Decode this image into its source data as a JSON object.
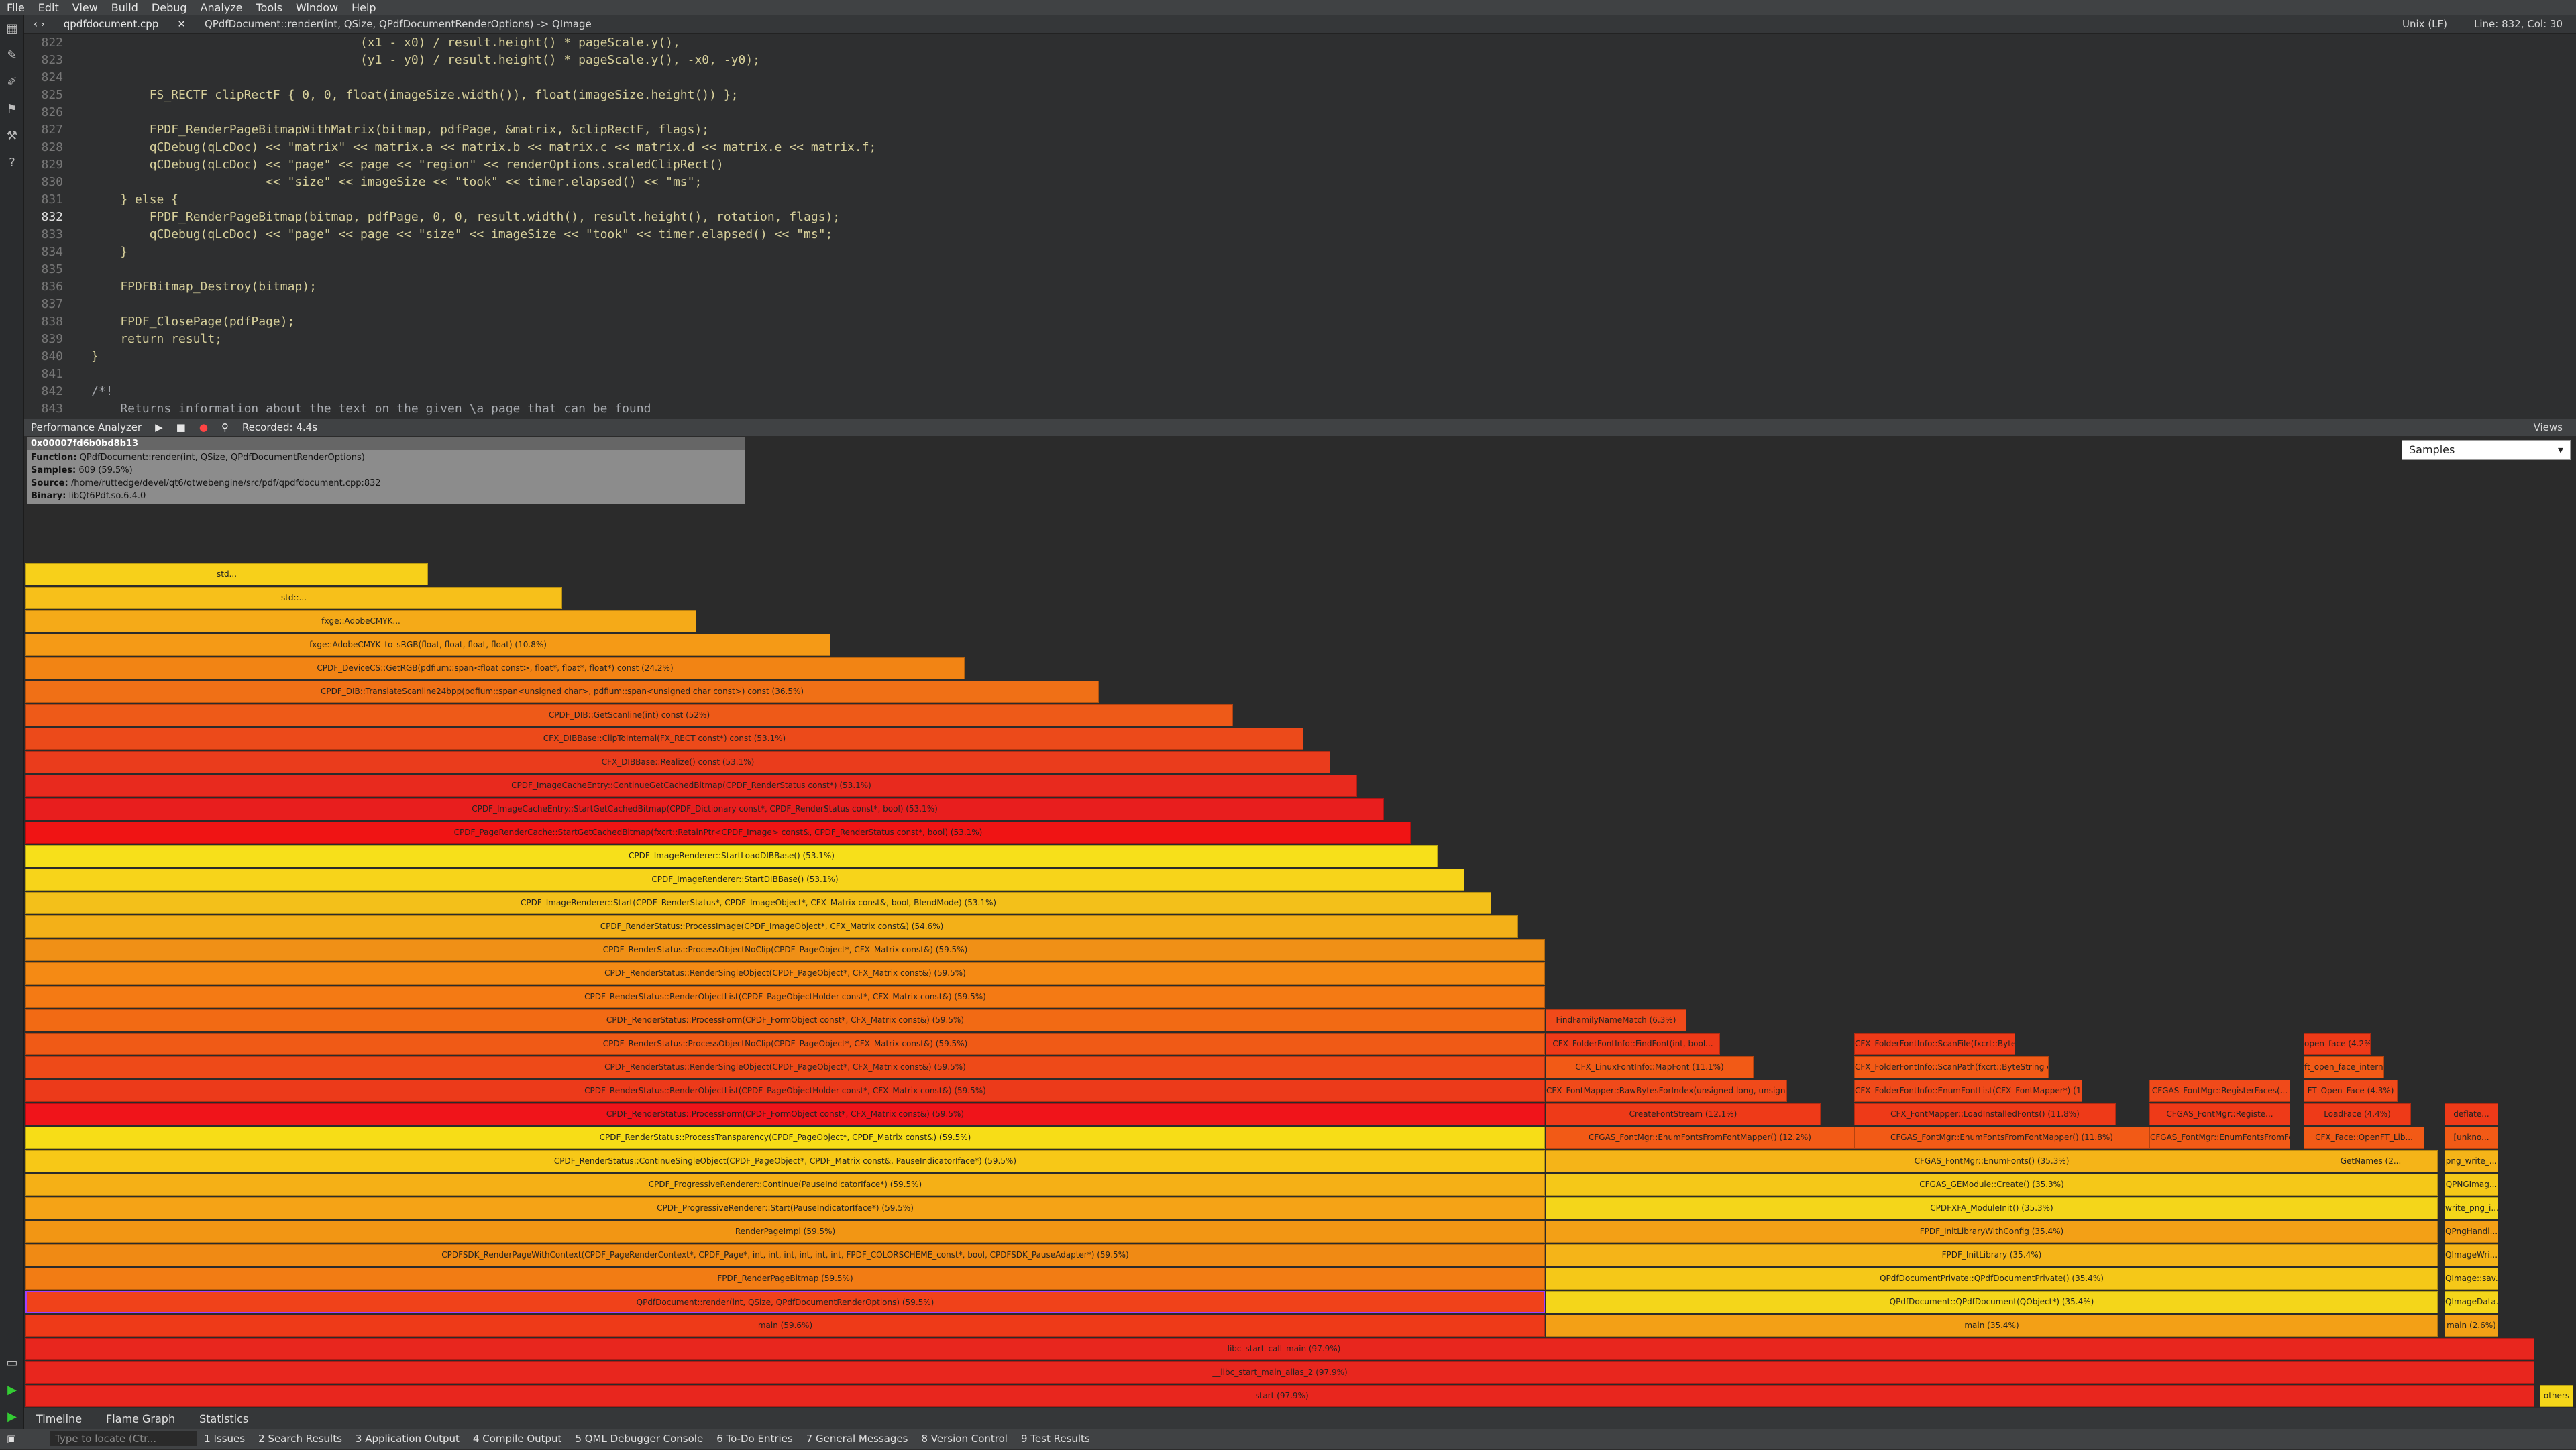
{
  "menu": [
    "File",
    "Edit",
    "View",
    "Build",
    "Debug",
    "Analyze",
    "Tools",
    "Window",
    "Help"
  ],
  "editor_toolbar": {
    "file": "qpdfdocument.cpp",
    "function": "QPdfDocument::render(int, QSize, QPdfDocumentRenderOptions) -> QImage",
    "encoding": "Unix (LF)",
    "position": "Line: 832, Col: 30"
  },
  "code_lines": [
    {
      "n": "822",
      "text": "                                     (x1 - x0) / result.height() * pageScale.y(),"
    },
    {
      "n": "823",
      "text": "                                     (y1 - y0) / result.height() * pageScale.y(), -x0, -y0);"
    },
    {
      "n": "824",
      "text": ""
    },
    {
      "n": "825",
      "text": "        FS_RECTF clipRectF { 0, 0, float(imageSize.width()), float(imageSize.height()) };"
    },
    {
      "n": "826",
      "text": ""
    },
    {
      "n": "827",
      "text": "        FPDF_RenderPageBitmapWithMatrix(bitmap, pdfPage, &matrix, &clipRectF, flags);"
    },
    {
      "n": "828",
      "text": "        qCDebug(qLcDoc) << \"matrix\" << matrix.a << matrix.b << matrix.c << matrix.d << matrix.e << matrix.f;"
    },
    {
      "n": "829",
      "text": "        qCDebug(qLcDoc) << \"page\" << page << \"region\" << renderOptions.scaledClipRect()"
    },
    {
      "n": "830",
      "text": "                        << \"size\" << imageSize << \"took\" << timer.elapsed() << \"ms\";"
    },
    {
      "n": "831",
      "text": "    } else {"
    },
    {
      "n": "832",
      "text": "        FPDF_RenderPageBitmap(bitmap, pdfPage, 0, 0, result.width(), result.height(), rotation, flags);"
    },
    {
      "n": "833",
      "text": "        qCDebug(qLcDoc) << \"page\" << page << \"size\" << imageSize << \"took\" << timer.elapsed() << \"ms\";"
    },
    {
      "n": "834",
      "text": "    }"
    },
    {
      "n": "835",
      "text": ""
    },
    {
      "n": "836",
      "text": "    FPDFBitmap_Destroy(bitmap);"
    },
    {
      "n": "837",
      "text": ""
    },
    {
      "n": "838",
      "text": "    FPDF_ClosePage(pdfPage);"
    },
    {
      "n": "839",
      "text": "    return result;"
    },
    {
      "n": "840",
      "text": "}"
    },
    {
      "n": "841",
      "text": ""
    },
    {
      "n": "842",
      "text": "/*!"
    },
    {
      "n": "843",
      "text": "    Returns information about the text on the given \\a page that can be found"
    }
  ],
  "perf_toolbar": {
    "title": "Performance Analyzer",
    "recorded": "Recorded: 4.4s",
    "views": "Views"
  },
  "tooltip": {
    "address": "0x00007fd6b0bd8b13",
    "function_label": "Function:",
    "function": "QPdfDocument::render(int, QSize, QPdfDocumentRenderOptions)",
    "samples_label": "Samples:",
    "samples": "609 (59.5%)",
    "source_label": "Source:",
    "source": "/home/ruttedge/devel/qt6/qtwebengine/src/pdf/qpdfdocument.cpp:832",
    "binary_label": "Binary:",
    "binary": "libQt6Pdf.so.6.4.0"
  },
  "samples_select": "Samples",
  "flame_rows": [
    {
      "label": "_start (97.9%)",
      "color": "#e8261e"
    },
    {
      "label": "__libc_start_main_alias_2 (97.9%)",
      "color": "#e8261e"
    },
    {
      "label": "__libc_start_call_main (97.9%)",
      "color": "#e8261e"
    },
    {
      "label": "main (59.6%)",
      "color": "#ee3a18"
    },
    {
      "label": "QPdfDocument::render(int, QSize, QPdfDocumentRenderOptions) (59.5%)",
      "color": "#f0421a"
    },
    {
      "label": "FPDF_RenderPageBitmap (59.5%)",
      "color": "#f27c14"
    },
    {
      "label": "CPDFSDK_RenderPageWithContext(CPDF_PageRenderContext*, CPDF_Page*, int, int, int, int, int, int, FPDF_COLORSCHEME_const*, bool, CPDFSDK_PauseAdapter*) (59.5%)",
      "color": "#f08a14"
    },
    {
      "label": "RenderPageImpl (59.5%)",
      "color": "#f29614"
    },
    {
      "label": "CPDF_ProgressiveRenderer::Start(PauseIndicatorIface*) (59.5%)",
      "color": "#f5a316"
    },
    {
      "label": "CPDF_ProgressiveRenderer::Continue(PauseIndicatorIface*) (59.5%)",
      "color": "#f5b016"
    },
    {
      "label": "CPDF_RenderStatus::ContinueSingleObject(CPDF_PageObject*, CPDF_Matrix const&, PauseIndicatorIface*) (59.5%)",
      "color": "#f7c817"
    },
    {
      "label": "CPDF_RenderStatus::ProcessTransparency(CPDF_PageObject*, CPDF_Matrix const&) (59.5%)",
      "color": "#f7dd17"
    },
    {
      "label": "CPDF_RenderStatus::ProcessForm(CPDF_FormObject const*, CFX_Matrix const&) (59.5%)",
      "color": "#f0141a"
    },
    {
      "label": "CPDF_RenderStatus::RenderObjectList(CPDF_PageObjectHolder const*, CFX_Matrix const&) (59.5%)",
      "color": "#ec3a1a"
    },
    {
      "label": "CPDF_RenderStatus::RenderSingleObject(CPDF_PageObject*, CFX_Matrix const&) (59.5%)",
      "color": "#ee4a18"
    },
    {
      "label": "CPDF_RenderStatus::ProcessObjectNoClip(CPDF_PageObject*, CFX_Matrix const&) (59.5%)",
      "color": "#f05a16"
    },
    {
      "label": "CPDF_RenderStatus::ProcessForm(CPDF_FormObject const*, CFX_Matrix const&) (59.5%)",
      "color": "#f26a14"
    },
    {
      "label": "CPDF_RenderStatus::RenderObjectList(CPDF_PageObjectHolder const*, CFX_Matrix const&) (59.5%)",
      "color": "#f47a14"
    },
    {
      "label": "CPDF_RenderStatus::RenderSingleObject(CPDF_PageObject*, CFX_Matrix const&) (59.5%)",
      "color": "#f58a14"
    },
    {
      "label": "CPDF_RenderStatus::ProcessObjectNoClip(CPDF_PageObject*, CFX_Matrix const&) (59.5%)",
      "color": "#f09016"
    },
    {
      "label": "CPDF_RenderStatus::ProcessImage(CPDF_ImageObject*, CFX_Matrix const&) (54.6%)",
      "color": "#f3b018"
    },
    {
      "label": "CPDF_ImageRenderer::Start(CPDF_RenderStatus*, CPDF_ImageObject*, CFX_Matrix const&, bool, BlendMode) (53.1%)",
      "color": "#f3c01a"
    },
    {
      "label": "CPDF_ImageRenderer::StartDIBBase() (53.1%)",
      "color": "#f7d41a"
    },
    {
      "label": "CPDF_ImageRenderer::StartLoadDIBBase() (53.1%)",
      "color": "#f7e01a"
    },
    {
      "label": "CPDF_PageRenderCache::StartGetCachedBitmap(fxcrt::RetainPtr<CPDF_Image> const&, CPDF_RenderStatus const*, bool) (53.1%)",
      "color": "#f01414"
    },
    {
      "label": "CPDF_ImageCacheEntry::StartGetCachedBitmap(CPDF_Dictionary const*, CPDF_RenderStatus const*, bool) (53.1%)",
      "color": "#e81e1e"
    },
    {
      "label": "CPDF_ImageCacheEntry::ContinueGetCachedBitmap(CPDF_RenderStatus const*) (53.1%)",
      "color": "#e82a1e"
    },
    {
      "label": "CFX_DIBBase::Realize() const (53.1%)",
      "color": "#ea3c1c"
    },
    {
      "label": "CFX_DIBBase::ClipToInternal(FX_RECT const*) const (53.1%)",
      "color": "#ec4a1a"
    },
    {
      "label": "CPDF_DIB::GetScanline(int) const (52%)",
      "color": "#ee5a18"
    },
    {
      "label": "CPDF_DIB::TranslateScanline24bpp(pdfium::span<unsigned char>, pdfium::span<unsigned char const>) const (36.5%)",
      "color": "#f07016"
    },
    {
      "label": "CPDF_DeviceCS::GetRGB(pdfium::span<float const>, float*, float*, float*) const (24.2%)",
      "color": "#f28414"
    },
    {
      "label": "fxge::AdobeCMYK_to_sRGB(float, float, float, float) (10.8%)",
      "color": "#f59a16"
    },
    {
      "label": "fxge::AdobeCMYK...",
      "color": "#f5aa18"
    },
    {
      "label": "std::...",
      "color": "#f7c01a"
    },
    {
      "label": "std...",
      "color": "#f7d01a"
    }
  ],
  "flame_right": [
    {
      "label": "main (35.4%)"
    },
    {
      "label": "QPdfDocument::QPdfDocument(QObject*) (35.4%)"
    },
    {
      "label": "QPdfDocumentPrivate::QPdfDocumentPrivate() (35.4%)"
    },
    {
      "label": "FPDF_InitLibrary (35.4%)"
    },
    {
      "label": "FPDF_InitLibraryWithConfig (35.4%)"
    },
    {
      "label": "CPDFXFA_ModuleInit() (35.3%)"
    },
    {
      "label": "CFGAS_GEModule::Create() (35.3%)"
    },
    {
      "label": "CFGAS_FontMgr::EnumFonts() (35.3%)"
    },
    {
      "label": "CFGAS_FontMgr::EnumFontsFromFontMapper() (12.2%)"
    },
    {
      "label": "CreateFontStream (12.1%)"
    },
    {
      "label": "CFX_FontMapper::RawBytesForIndex(unsigned long, unsigned long)"
    },
    {
      "label": "CFX_LinuxFontInfo::MapFont (11.1%)"
    },
    {
      "label": "CFX_FolderFontInfo::FindFont(int, bool..."
    },
    {
      "label": "FindFamilyNameMatch (6.3%)"
    },
    {
      "label": "CFGAS_FontMgr::EnumFontsFromFontMapper() (11.8%)"
    },
    {
      "label": "CFX_FontMapper::LoadInstalledFonts() (11.8%)"
    },
    {
      "label": "CFX_FolderFontInfo::EnumFontList(CFX_FontMapper*) (11.8%)"
    },
    {
      "label": "CFX_FolderFontInfo::ScanPath(fxcrt::ByteString const&) (11.8%)"
    },
    {
      "label": "CFX_FolderFontInfo::ScanFile(fxcrt::ByteString co..."
    },
    {
      "label": "CFGAS_FontMgr::EnumFontsFromFontMapper() (10.4%)"
    },
    {
      "label": "CFGAS_FontMgr::Registe..."
    },
    {
      "label": "CFGAS_FontMgr::RegisterFaces(..."
    },
    {
      "label": "GetNames (2..."
    },
    {
      "label": "CFX_Face::OpenFT_Lib..."
    },
    {
      "label": "LoadFace (4.4%)"
    },
    {
      "label": "FT_Open_Face (4.3%)"
    },
    {
      "label": "ft_open_face_internal (..."
    },
    {
      "label": "open_face (4.2%)"
    },
    {
      "label": "main (2.6%)"
    },
    {
      "label": "QImageData..."
    },
    {
      "label": "QImage::sav..."
    },
    {
      "label": "QImageWri..."
    },
    {
      "label": "QPngHandl..."
    },
    {
      "label": "write_png_i..."
    },
    {
      "label": "QPNGImag..."
    },
    {
      "label": "png_write_..."
    },
    {
      "label": "[unkno..."
    },
    {
      "label": "deflate..."
    },
    {
      "label": "others"
    }
  ],
  "bottom_tabs": [
    "Timeline",
    "Flame Graph",
    "Statistics"
  ],
  "status": {
    "locate_placeholder": "Type to locate (Ctr...",
    "items": [
      "1 Issues",
      "2 Search Results",
      "3 Application Output",
      "4 Compile Output",
      "5 QML Debugger Console",
      "6 To-Do Entries",
      "7 General Messages",
      "8 Version Control",
      "9 Test Results"
    ]
  }
}
